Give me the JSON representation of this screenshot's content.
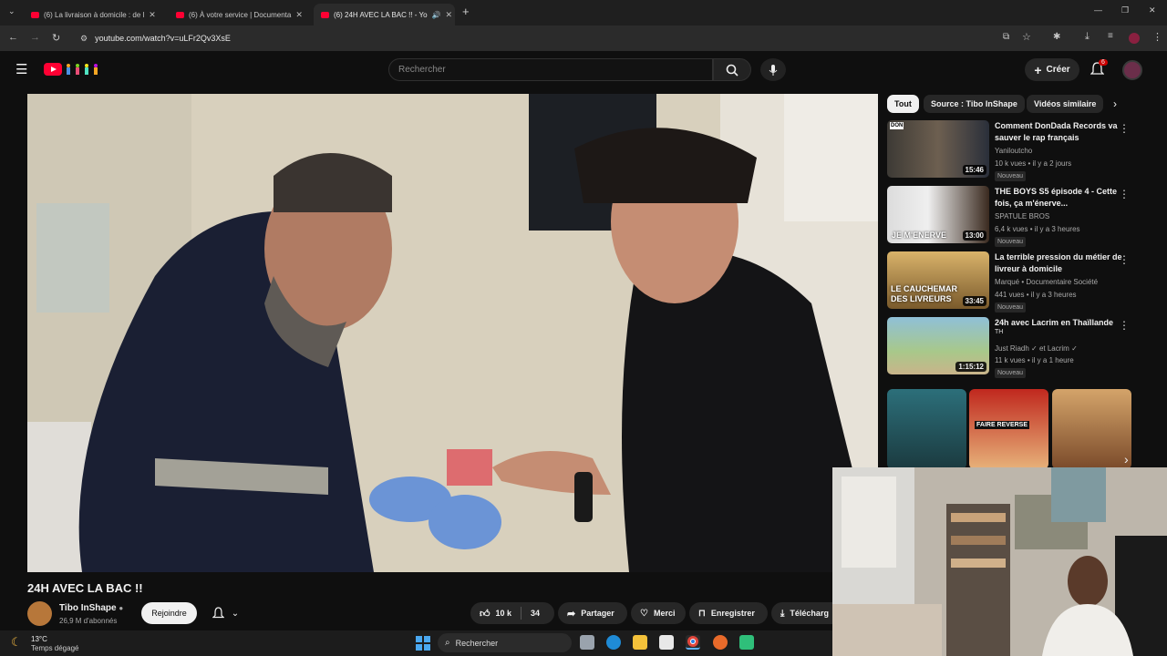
{
  "browser": {
    "tabs": [
      {
        "label": "(6) La livraison à domicile : de l"
      },
      {
        "label": "(6) À votre service | Documenta"
      },
      {
        "label": "(6) 24H AVEC LA BAC !! - Yo"
      }
    ],
    "url": "youtube.com/watch?v=uLFr2Qv3XsE",
    "new_tab": "+"
  },
  "header": {
    "search_placeholder": "Rechercher",
    "create_label": "Créer",
    "notifications_count": "6"
  },
  "video": {
    "title": "24H AVEC LA BAC !!",
    "channel": "Tibo InShape",
    "subscribers": "26,9 M d'abonnés",
    "join_label": "Rejoindre",
    "likes": "10 k",
    "dislikes": "34",
    "share_label": "Partager",
    "thanks_label": "Merci",
    "save_label": "Enregistrer",
    "download_label": "Télécharg"
  },
  "chips": [
    {
      "label": "Tout"
    },
    {
      "label": "Source : Tibo InShape"
    },
    {
      "label": "Vidéos similaire"
    }
  ],
  "recommendations": [
    {
      "title": "Comment DonDada Records va sauver le rap français",
      "channel": "Yaniloutcho",
      "meta": "10 k vues • il y a 2 jours",
      "badge": "Nouveau",
      "duration": "15:46"
    },
    {
      "title": "THE BOYS S5 épisode 4 - Cette fois, ça m'énerve...",
      "channel": "SPATULE BROS",
      "meta": "6,4 k vues • il y a 3 heures",
      "badge": "Nouveau",
      "duration": "13:00",
      "thumb_text": "JE M'ENERVE"
    },
    {
      "title": "La terrible pression du métier de livreur à domicile",
      "channel": "Marqué • Documentaire Société",
      "meta": "441 vues • il y a 3 heures",
      "badge": "Nouveau",
      "duration": "33:45",
      "thumb_text": "LE CAUCHEMAR DES LIVREURS"
    },
    {
      "title": "24h avec Lacrim en Thaïllande",
      "subtitle": "TH",
      "channel": "Just Riadh ✓ et Lacrim ✓",
      "meta": "11 k vues • il y a 1 heure",
      "badge": "Nouveau",
      "duration": "1:15:12"
    }
  ],
  "shorts": [
    {
      "text": ""
    },
    {
      "text": "FAIRE REVERSE"
    },
    {
      "text": ""
    }
  ],
  "taskbar": {
    "temperature": "13°C",
    "weather": "Temps dégagé",
    "search_label": "Rechercher"
  },
  "colors": {
    "accent": "#ff0033",
    "background": "#0f0f0f"
  }
}
